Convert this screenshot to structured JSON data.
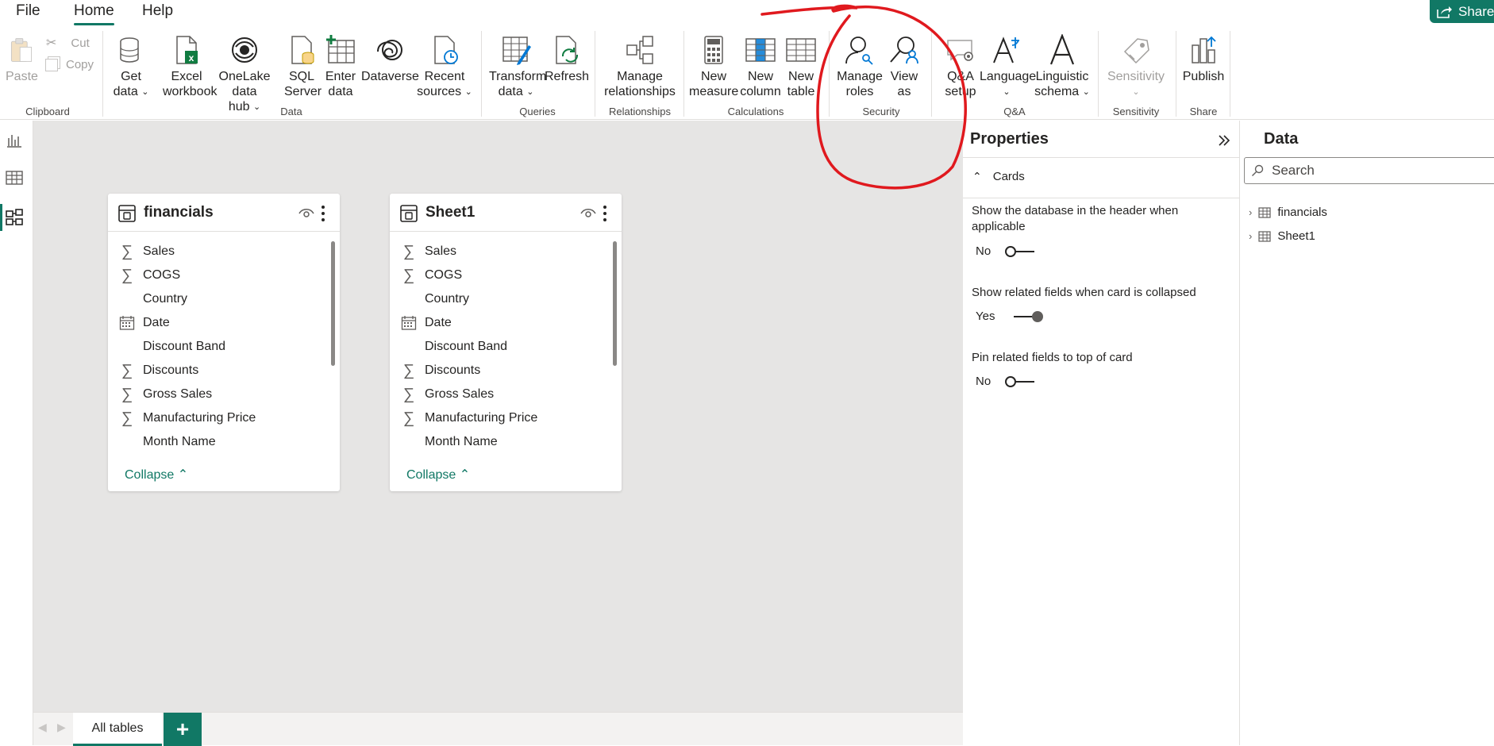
{
  "menu": {
    "file": "File",
    "home": "Home",
    "help": "Help",
    "share": "Share"
  },
  "ribbon": {
    "clipboard": {
      "paste": "Paste",
      "cut": "Cut",
      "copy": "Copy",
      "group": "Clipboard"
    },
    "data": {
      "get_data": [
        "Get",
        "data"
      ],
      "excel": [
        "Excel",
        "workbook"
      ],
      "onelake": [
        "OneLake data",
        "hub"
      ],
      "sql": [
        "SQL",
        "Server"
      ],
      "enter": [
        "Enter",
        "data"
      ],
      "dataverse": "Dataverse",
      "recent": [
        "Recent",
        "sources"
      ],
      "group": "Data"
    },
    "queries": {
      "transform": [
        "Transform",
        "data"
      ],
      "refresh": "Refresh",
      "group": "Queries"
    },
    "relationships": {
      "manage": [
        "Manage",
        "relationships"
      ],
      "group": "Relationships"
    },
    "calculations": {
      "new_measure": [
        "New",
        "measure"
      ],
      "new_column": [
        "New",
        "column"
      ],
      "new_table": [
        "New",
        "table"
      ],
      "group": "Calculations"
    },
    "security": {
      "manage_roles": [
        "Manage",
        "roles"
      ],
      "view_as": [
        "View",
        "as"
      ],
      "group": "Security"
    },
    "qa": {
      "qa_setup": [
        "Q&A",
        "setup"
      ],
      "language": "Language",
      "linguistic": [
        "Linguistic",
        "schema"
      ],
      "group": "Q&A"
    },
    "sensitivity": {
      "label": "Sensitivity",
      "group": "Sensitivity"
    },
    "share": {
      "publish": "Publish",
      "group": "Share"
    }
  },
  "cards": [
    {
      "title": "financials",
      "fields": [
        {
          "name": "Sales",
          "icon": "sigma"
        },
        {
          "name": "COGS",
          "icon": "sigma"
        },
        {
          "name": "Country",
          "icon": "none"
        },
        {
          "name": "Date",
          "icon": "calendar"
        },
        {
          "name": "Discount Band",
          "icon": "none"
        },
        {
          "name": "Discounts",
          "icon": "sigma"
        },
        {
          "name": "Gross Sales",
          "icon": "sigma"
        },
        {
          "name": "Manufacturing Price",
          "icon": "sigma"
        },
        {
          "name": "Month Name",
          "icon": "none"
        }
      ],
      "collapse": "Collapse"
    },
    {
      "title": "Sheet1",
      "fields": [
        {
          "name": "Sales",
          "icon": "sigma"
        },
        {
          "name": "COGS",
          "icon": "sigma"
        },
        {
          "name": "Country",
          "icon": "none"
        },
        {
          "name": "Date",
          "icon": "calendar"
        },
        {
          "name": "Discount Band",
          "icon": "none"
        },
        {
          "name": "Discounts",
          "icon": "sigma"
        },
        {
          "name": "Gross Sales",
          "icon": "sigma"
        },
        {
          "name": "Manufacturing Price",
          "icon": "sigma"
        },
        {
          "name": "Month Name",
          "icon": "none"
        }
      ],
      "collapse": "Collapse"
    }
  ],
  "tabs": {
    "all_tables": "All tables",
    "add": "+"
  },
  "properties": {
    "title": "Properties",
    "section": "Cards",
    "options": [
      {
        "label": "Show the database in the header when applicable",
        "value": "No",
        "on": false
      },
      {
        "label": "Show related fields when card is collapsed",
        "value": "Yes",
        "on": true
      },
      {
        "label": "Pin related fields to top of card",
        "value": "No",
        "on": false
      }
    ]
  },
  "data_pane": {
    "title": "Data",
    "search_placeholder": "Search",
    "tables": [
      "financials",
      "Sheet1"
    ]
  },
  "colors": {
    "accent": "#117865",
    "annotation": "#e0191e"
  }
}
